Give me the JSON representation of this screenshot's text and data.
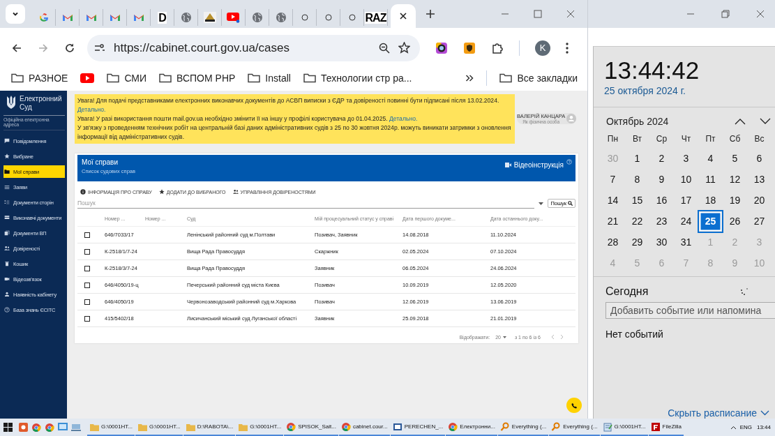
{
  "browser": {
    "tabs": [
      {
        "kind": "google",
        "selected": false
      },
      {
        "kind": "gmail",
        "selected": false
      },
      {
        "kind": "gmail",
        "selected": false
      },
      {
        "kind": "gmail",
        "selected": false
      },
      {
        "kind": "gmail",
        "selected": false
      },
      {
        "kind": "letter",
        "label": "D",
        "selected": false
      },
      {
        "kind": "globe",
        "selected": false
      },
      {
        "kind": "pma",
        "selected": false
      },
      {
        "kind": "youtube",
        "selected": false
      },
      {
        "kind": "globe",
        "selected": false
      },
      {
        "kind": "globe",
        "selected": false
      },
      {
        "kind": "blank",
        "selected": false
      },
      {
        "kind": "blank",
        "selected": false
      },
      {
        "kind": "blank",
        "selected": false
      },
      {
        "kind": "letter",
        "label": "RAZ",
        "selected": false
      },
      {
        "kind": "empty",
        "selected": true
      }
    ],
    "url": "https://cabinet.court.gov.ua/cases",
    "profile_initial": "K",
    "bookmarks": [
      {
        "kind": "folder",
        "label": "РАЗНОЕ"
      },
      {
        "kind": "youtube"
      },
      {
        "kind": "folder",
        "label": "СМИ"
      },
      {
        "kind": "folder",
        "label": "ВСПОМ PHP"
      },
      {
        "kind": "folder",
        "label": "Install"
      },
      {
        "kind": "folder",
        "label": "Технологии стр ра..."
      }
    ],
    "all_bookmarks": "Все закладки"
  },
  "site": {
    "logo": {
      "title": "Електронний Суд",
      "subtitle": "Офіційна електронна адреса"
    },
    "nav": [
      {
        "label": "Повідомлення",
        "kind": "message",
        "selected": false
      },
      {
        "label": "Вибране",
        "kind": "star",
        "selected": false
      },
      {
        "label": "Мої справи",
        "kind": "folder",
        "selected": true
      },
      {
        "label": "Заяви",
        "kind": "list",
        "selected": false
      },
      {
        "label": "Документи сторін",
        "kind": "checklist",
        "selected": false
      },
      {
        "label": "Виконавчі документи",
        "kind": "database",
        "selected": false
      },
      {
        "label": "Документи ВП",
        "kind": "copy",
        "selected": false
      },
      {
        "label": "Довіреності",
        "kind": "people",
        "selected": false
      },
      {
        "label": "Кошик",
        "kind": "trash",
        "selected": false
      },
      {
        "label": "Відеозв'язок",
        "kind": "video",
        "selected": false
      },
      {
        "label": "Наявність кабінету",
        "kind": "person",
        "selected": false
      },
      {
        "label": "База знань ЄСІТС",
        "kind": "help",
        "selected": false
      }
    ],
    "notices": [
      {
        "text": "Увага! Для подачі представниками електронних виконавчих документів до АСВП виписки з ЄДР та довіреності повинні бути підписані після 13.02.2024.",
        "link": "Детально."
      },
      {
        "text": "Увага! У разі використання пошти mail.gov.ua необхідно змінити її на іншу у профілі користувача до 01.04.2025.",
        "link": "Детально."
      },
      {
        "text": "У зв'язку з проведенням технічних робіт на центральній базі даних адміністративних судів з 25 по 30 жовтня 2024р. можуть виникати затримки з оновлення інформації від адміністративних судів."
      }
    ],
    "user": {
      "name": "ВАЛЕРІЙ КАНЦАРА",
      "role": "Як фізична особа"
    },
    "cases": {
      "title": "Мої справи",
      "subtitle": "Список судових справ",
      "video_link": "Відеоінструкція",
      "actions": [
        {
          "label": "ІНФОРМАЦІЯ ПРО СПРАВУ",
          "kind": "info"
        },
        {
          "label": "ДОДАТИ ДО ВИБРАНОГО",
          "kind": "star"
        },
        {
          "label": "УПРАВЛІННЯ ДОВІРЕНОСТЯМИ",
          "kind": "people"
        }
      ],
      "search": {
        "placeholder": "Пошук",
        "button": "Пошук"
      },
      "columns": [
        "Номер ...",
        "Номер ...",
        "Суд",
        "Мій процесуальний статус у справі",
        "Дата першого докуме...",
        "Дата останнього доку..."
      ],
      "rows": [
        {
          "checked": false,
          "number": "646/7033/17",
          "court": "Ленінський районний суд м.Полтави",
          "status": "Позивач, Заявник",
          "first": "14.08.2018",
          "last": "11.10.2024"
        },
        {
          "checked": false,
          "number": "К-2518/1/7-24",
          "court": "Вища Рада Правосуддя",
          "status": "Скаржник",
          "first": "02.05.2024",
          "last": "07.10.2024"
        },
        {
          "checked": false,
          "number": "К-2518/3/7-24",
          "court": "Вища Рада Правосуддя",
          "status": "Заявник",
          "first": "06.05.2024",
          "last": "24.06.2024"
        },
        {
          "checked": false,
          "number": "646/4050/19-ц",
          "court": "Печерський районний суд міста Києва",
          "status": "Позивач",
          "first": "10.09.2019",
          "last": "12.05.2020"
        },
        {
          "checked": false,
          "number": "646/4050/19",
          "court": "Червонозаводський районний суд м.Харкова",
          "status": "Позивач",
          "first": "12.06.2019",
          "last": "13.06.2019"
        },
        {
          "checked": false,
          "number": "415/5402/18",
          "court": "Лисичанський міський суд Луганської області",
          "status": "Заявник",
          "first": "25.09.2018",
          "last": "21.01.2019"
        }
      ],
      "footer": {
        "rows_label": "Відображати:",
        "rows_per_page": "20",
        "range": "з 1 по 6 із 6"
      }
    }
  },
  "calendar": {
    "time": "13:44:42",
    "date": "25 октября 2024 г.",
    "month": "Октябрь 2024",
    "weekdays": [
      "Пн",
      "Вт",
      "Ср",
      "Чт",
      "Пт",
      "Сб",
      "Вс"
    ],
    "days": [
      {
        "label": "30",
        "muted": true,
        "selected": false
      },
      {
        "label": "1",
        "muted": false,
        "selected": false
      },
      {
        "label": "2",
        "muted": false,
        "selected": false
      },
      {
        "label": "3",
        "muted": false,
        "selected": false
      },
      {
        "label": "4",
        "muted": false,
        "selected": false
      },
      {
        "label": "5",
        "muted": false,
        "selected": false
      },
      {
        "label": "6",
        "muted": false,
        "selected": false
      },
      {
        "label": "7",
        "muted": false,
        "selected": false
      },
      {
        "label": "8",
        "muted": false,
        "selected": false
      },
      {
        "label": "9",
        "muted": false,
        "selected": false
      },
      {
        "label": "10",
        "muted": false,
        "selected": false
      },
      {
        "label": "11",
        "muted": false,
        "selected": false
      },
      {
        "label": "12",
        "muted": false,
        "selected": false
      },
      {
        "label": "13",
        "muted": false,
        "selected": false
      },
      {
        "label": "14",
        "muted": false,
        "selected": false
      },
      {
        "label": "15",
        "muted": false,
        "selected": false
      },
      {
        "label": "16",
        "muted": false,
        "selected": false
      },
      {
        "label": "17",
        "muted": false,
        "selected": false
      },
      {
        "label": "18",
        "muted": false,
        "selected": false
      },
      {
        "label": "19",
        "muted": false,
        "selected": false
      },
      {
        "label": "20",
        "muted": false,
        "selected": false
      },
      {
        "label": "21",
        "muted": false,
        "selected": false
      },
      {
        "label": "22",
        "muted": false,
        "selected": false
      },
      {
        "label": "23",
        "muted": false,
        "selected": false
      },
      {
        "label": "24",
        "muted": false,
        "selected": false
      },
      {
        "label": "25",
        "muted": false,
        "selected": true
      },
      {
        "label": "26",
        "muted": false,
        "selected": false
      },
      {
        "label": "27",
        "muted": false,
        "selected": false
      },
      {
        "label": "28",
        "muted": false,
        "selected": false
      },
      {
        "label": "29",
        "muted": false,
        "selected": false
      },
      {
        "label": "30",
        "muted": false,
        "selected": false
      },
      {
        "label": "31",
        "muted": false,
        "selected": false
      },
      {
        "label": "1",
        "muted": true,
        "selected": false
      },
      {
        "label": "2",
        "muted": true,
        "selected": false
      },
      {
        "label": "3",
        "muted": true,
        "selected": false
      },
      {
        "label": "4",
        "muted": true,
        "selected": false
      },
      {
        "label": "5",
        "muted": true,
        "selected": false
      },
      {
        "label": "6",
        "muted": true,
        "selected": false
      },
      {
        "label": "7",
        "muted": true,
        "selected": false
      },
      {
        "label": "8",
        "muted": true,
        "selected": false
      },
      {
        "label": "9",
        "muted": true,
        "selected": false
      },
      {
        "label": "10",
        "muted": true,
        "selected": false
      }
    ],
    "today": "Сегодня",
    "event_placeholder": "Добавить событие или напомина",
    "no_events": "Нет событий",
    "hide_schedule": "Скрыть расписание"
  },
  "taskbar": {
    "items": [
      {
        "kind": "folder",
        "label": "G:\\0001HT..."
      },
      {
        "kind": "folder",
        "label": "G:\\0001HT..."
      },
      {
        "kind": "folder",
        "label": "D:\\RABOTA\\..."
      },
      {
        "kind": "folder",
        "label": "G:\\0001HT..."
      },
      {
        "kind": "chrome",
        "label": "SPISOK_Sait..."
      },
      {
        "kind": "chrome",
        "label": "cabinet.cour..."
      },
      {
        "kind": "document",
        "label": "PERECHEN_..."
      },
      {
        "kind": "chrome",
        "label": "Електронни..."
      },
      {
        "kind": "search",
        "label": "Everything (..."
      },
      {
        "kind": "search",
        "label": "Everything (..."
      },
      {
        "kind": "notepad",
        "label": "G:\\0001HT..."
      },
      {
        "kind": "filezilla",
        "label": "FileZilla"
      }
    ],
    "language": "ENG",
    "time": "13:44"
  }
}
